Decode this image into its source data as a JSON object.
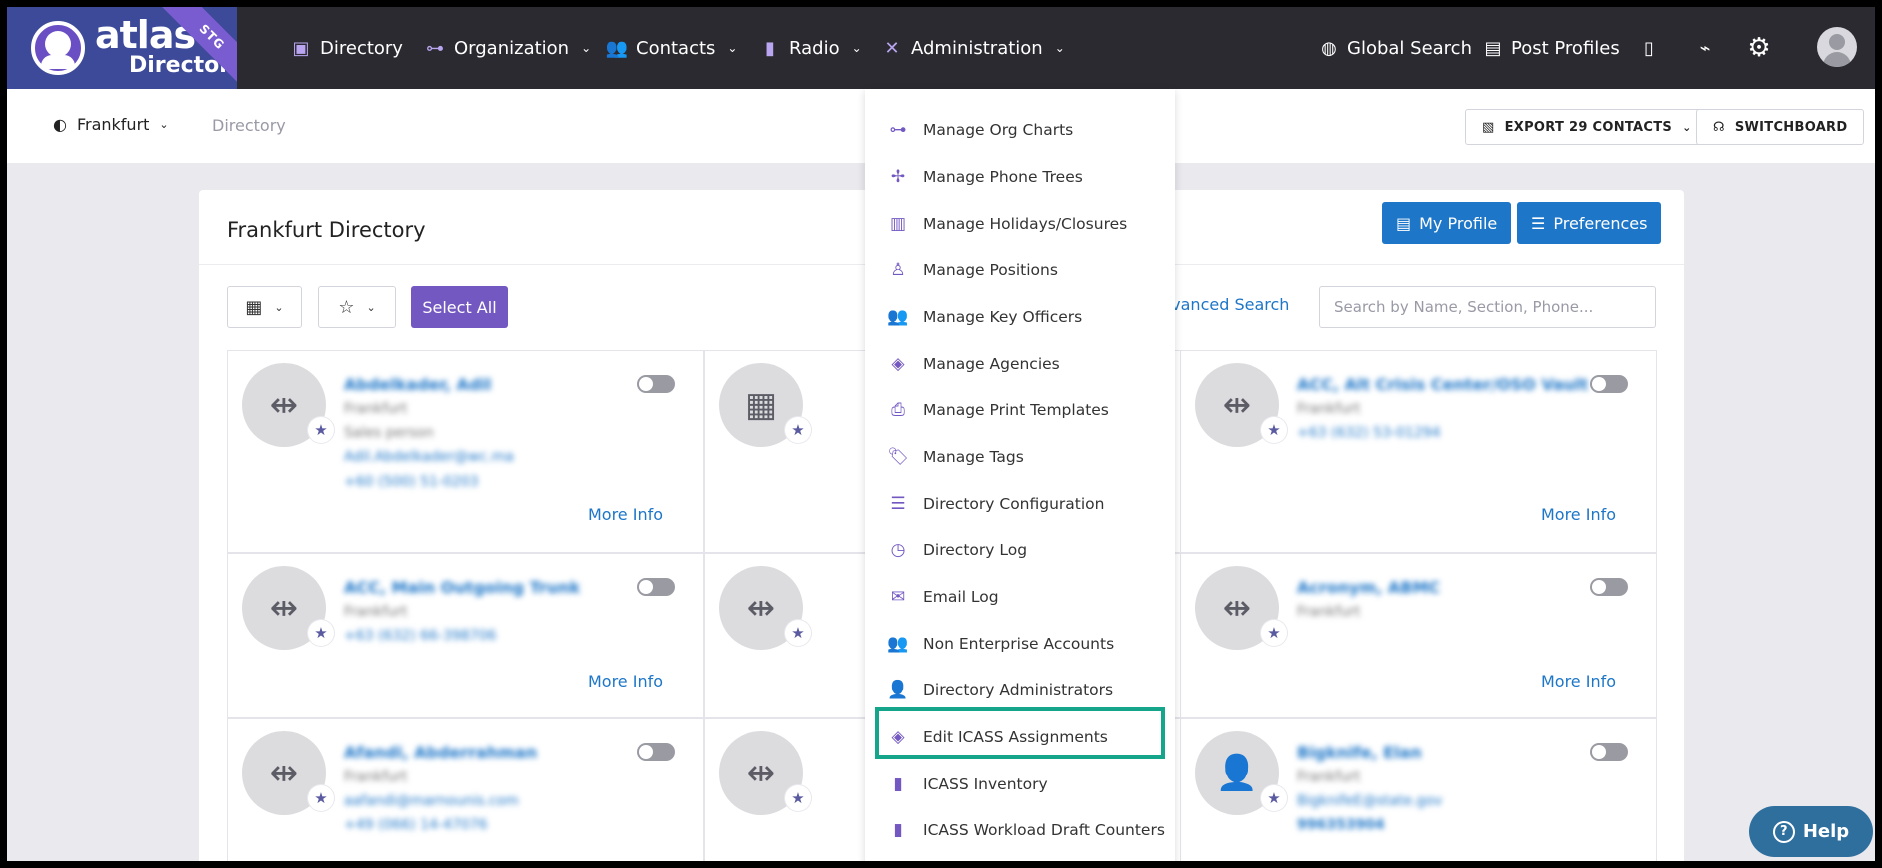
{
  "logo": {
    "line1": "atlas",
    "line2": "Directory",
    "badge": "STG"
  },
  "nav": {
    "directory": "Directory",
    "organization": "Organization",
    "contacts": "Contacts",
    "radio": "Radio",
    "administration": "Administration",
    "global_search": "Global Search",
    "post_profiles": "Post Profiles"
  },
  "subbar": {
    "location": "Frankfurt",
    "breadcrumb": "Directory",
    "export_label": "EXPORT 29 CONTACTS",
    "switchboard_label": "SWITCHBOARD"
  },
  "card": {
    "title": "Frankfurt Directory",
    "my_profile": "My Profile",
    "preferences": "Preferences",
    "select_all": "Select All",
    "advanced_search": "dvanced Search",
    "search_placeholder": "Search by Name, Section, Phone..."
  },
  "tiles": [
    {
      "name": "Abdelkader, Adil",
      "lines": [
        "Frankfurt",
        "Sales person",
        "Adil.Abdelkader@wc.ma",
        "+60 (500) 51-0203"
      ],
      "more": "More Info"
    },
    {
      "name": "",
      "lines": [],
      "more": ""
    },
    {
      "name": "ACC, Alt Crisis Center/OSO Vault",
      "lines": [
        "Frankfurt",
        "+63 (632) 53-01294"
      ],
      "more": "More Info"
    },
    {
      "name": "ACC, Main Outgoing Trunk",
      "lines": [
        "Frankfurt",
        "+63 (632) 66-398706"
      ],
      "more": "More Info"
    },
    {
      "name": "",
      "lines": [],
      "more": ""
    },
    {
      "name": "Acronym, ABMC",
      "lines": [
        "Frankfurt"
      ],
      "more": "More Info"
    },
    {
      "name": "Afandi, Abderrahman",
      "lines": [
        "Frankfurt",
        "aafandi@marnounis.com",
        "+49 (066) 14-47076"
      ],
      "more": ""
    },
    {
      "name": "",
      "lines": [],
      "more": ""
    },
    {
      "name": "Bigknife, Elan",
      "lines": [
        "Frankfurt",
        "BigknifeE@state.gov",
        "996353904"
      ],
      "more": ""
    }
  ],
  "admin_menu": [
    {
      "label": "Manage Org Charts",
      "icon": "org-chart-icon"
    },
    {
      "label": "Manage Phone Trees",
      "icon": "phone-tree-icon"
    },
    {
      "label": "Manage Holidays/Closures",
      "icon": "building-icon"
    },
    {
      "label": "Manage Positions",
      "icon": "position-icon"
    },
    {
      "label": "Manage Key Officers",
      "icon": "key-officers-icon"
    },
    {
      "label": "Manage Agencies",
      "icon": "layers-icon"
    },
    {
      "label": "Manage Print Templates",
      "icon": "printer-icon"
    },
    {
      "label": "Manage Tags",
      "icon": "tags-icon"
    },
    {
      "label": "Directory Configuration",
      "icon": "sliders-icon"
    },
    {
      "label": "Directory Log",
      "icon": "clock-icon"
    },
    {
      "label": "Email Log",
      "icon": "envelope-icon"
    },
    {
      "label": "Non Enterprise Accounts",
      "icon": "users-icon"
    },
    {
      "label": "Directory Administrators",
      "icon": "user-shield-icon"
    },
    {
      "label": "Edit ICASS Assignments",
      "icon": "layers-icon"
    },
    {
      "label": "ICASS Inventory",
      "icon": "mobile-icon"
    },
    {
      "label": "ICASS Workload Draft Counters",
      "icon": "mobile-icon"
    }
  ],
  "help": {
    "label": "Help"
  },
  "colors": {
    "nav_bg": "#2a2a30",
    "accent_purple": "#7358c2",
    "link_blue": "#1d76c8",
    "highlight": "#14a58a"
  }
}
